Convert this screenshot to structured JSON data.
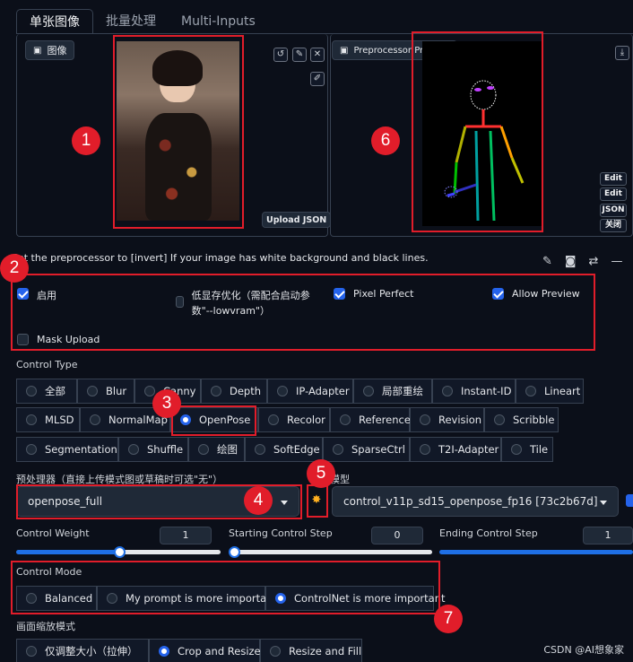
{
  "tabs": [
    {
      "label": "单张图像",
      "active": true
    },
    {
      "label": "批量处理",
      "active": false
    },
    {
      "label": "Multi-Inputs",
      "active": false
    }
  ],
  "image_panel": {
    "label": "图像",
    "upload_json": "Upload JSON"
  },
  "preview_panel": {
    "label": "Preprocessor Preview"
  },
  "side_buttons": [
    "Edit",
    "Edit",
    "JSON",
    "关闭"
  ],
  "hint_text": "Set the preprocessor to [invert] If your image has white background and black lines.",
  "checkboxes": {
    "enable": {
      "label": "启用",
      "checked": true
    },
    "low_vram": {
      "label": "低显存优化（需配合启动参数\"--lowvram\"）",
      "checked": false
    },
    "pixel_perfect": {
      "label": "Pixel Perfect",
      "checked": true
    },
    "allow_preview": {
      "label": "Allow Preview",
      "checked": true
    },
    "mask_upload": {
      "label": "Mask Upload",
      "checked": false
    }
  },
  "control_type": {
    "label": "Control Type",
    "rows": [
      [
        "全部",
        "Blur",
        "Canny",
        "Depth",
        "IP-Adapter",
        "局部重绘",
        "Instant-ID",
        "Lineart"
      ],
      [
        "MLSD",
        "NormalMap",
        "OpenPose",
        "Recolor",
        "Reference",
        "Revision",
        "Scribble"
      ],
      [
        "Segmentation",
        "Shuffle",
        "绘图",
        "SoftEdge",
        "SparseCtrl",
        "T2I-Adapter",
        "Tile"
      ]
    ],
    "selected": "OpenPose"
  },
  "preprocessor": {
    "label": "预处理器（直接上传模式图或草稿时可选\"无\"）",
    "value": "openpose_full"
  },
  "model": {
    "label": "模型",
    "value": "control_v11p_sd15_openpose_fp16 [73c2b67d]"
  },
  "sliders": {
    "weight": {
      "label": "Control Weight",
      "value": "1",
      "fraction": 0.5
    },
    "start": {
      "label": "Starting Control Step",
      "value": "0",
      "fraction": 0.0
    },
    "end": {
      "label": "Ending Control Step",
      "value": "1",
      "fraction": 1.0
    }
  },
  "control_mode": {
    "label": "Control Mode",
    "options": [
      "Balanced",
      "My prompt is more important",
      "ControlNet is more important"
    ],
    "selected": "ControlNet is more important"
  },
  "resize_mode": {
    "label": "画面缩放模式",
    "options": [
      "仅调整大小（拉伸）",
      "Crop and Resize",
      "Resize and Fill"
    ],
    "selected": "Crop and Resize"
  },
  "annotations": [
    "1",
    "2",
    "3",
    "4",
    "5",
    "6",
    "7"
  ],
  "watermark": "CSDN @AI想象家",
  "colors": {
    "accent": "#2563eb",
    "annotation": "#e11d2a",
    "background": "#0b0f19"
  }
}
